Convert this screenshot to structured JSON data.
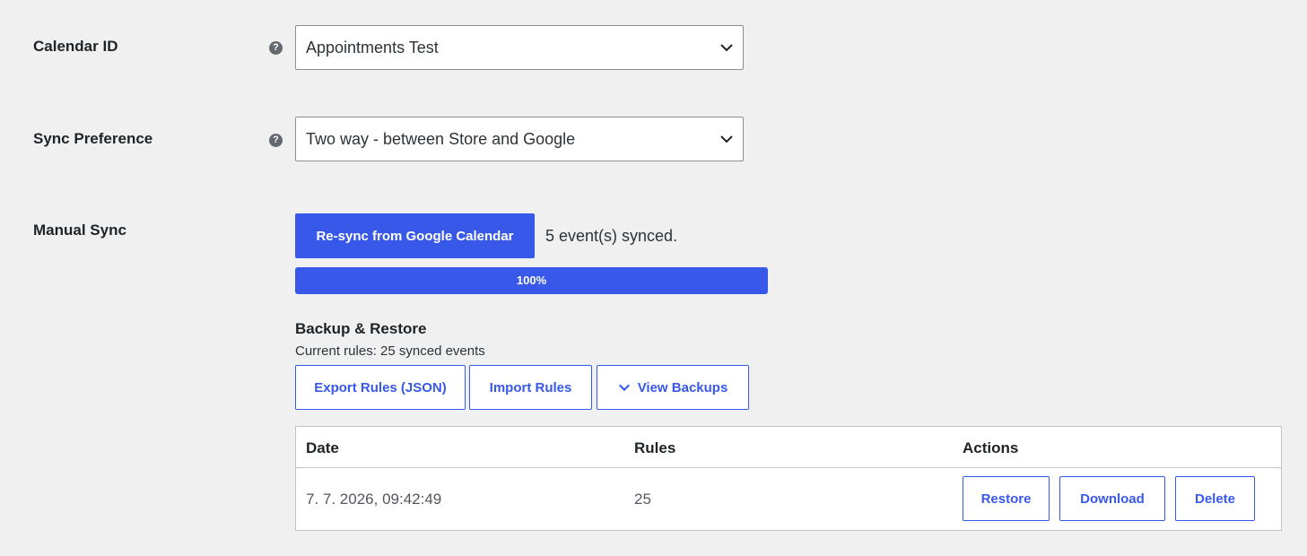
{
  "calendar_id": {
    "label": "Calendar ID",
    "help_icon": "?",
    "selected": "Appointments Test"
  },
  "sync_preference": {
    "label": "Sync Preference",
    "help_icon": "?",
    "selected": "Two way - between Store and Google"
  },
  "manual_sync": {
    "label": "Manual Sync",
    "resync_button": "Re-sync from Google Calendar",
    "status": "5 event(s) synced.",
    "progress_percent": 100,
    "progress_label": "100%"
  },
  "backup": {
    "title": "Backup & Restore",
    "current_rules": "Current rules: 25 synced events",
    "export_button": "Export Rules (JSON)",
    "import_button": "Import Rules",
    "view_backups_button": "View Backups",
    "table": {
      "headers": [
        "Date",
        "Rules",
        "Actions"
      ],
      "rows": [
        {
          "date": "7. 7. 2026, 09:42:49",
          "rules": "25"
        }
      ],
      "actions": {
        "restore": "Restore",
        "download": "Download",
        "delete": "Delete"
      }
    }
  },
  "colors": {
    "accent": "#3858e9",
    "background": "#f0f0f1",
    "text": "#1d2327"
  },
  "icons": [
    "help-icon",
    "chevron-down-icon"
  ]
}
